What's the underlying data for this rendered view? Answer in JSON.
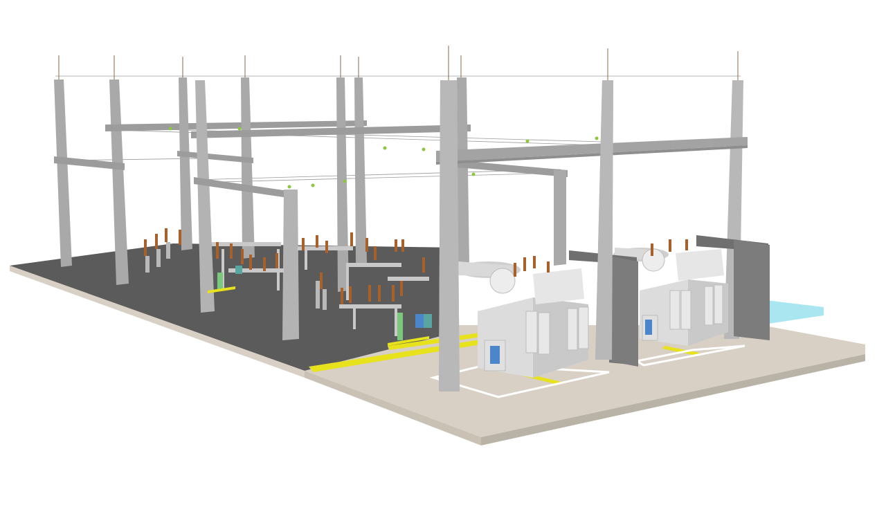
{
  "scene": {
    "subject": "substation-3d-render",
    "colors": {
      "background": "#ffffff",
      "asphalt": "#5b5b5b",
      "gravel": "#d8d0c4",
      "slab_edge": "#b9b2a6",
      "concrete": "#a9a9a9",
      "concrete_dark": "#8e8e8e",
      "concrete_light": "#c4c4c4",
      "insulator": "#a8612a",
      "cable_trench": "#e7e21b",
      "transformer": "#dcdcdc",
      "transformer_shadow": "#bdbdbd",
      "firewall": "#6f6f6f",
      "water": "#a9e6ef",
      "panel_blue": "#4a86c9"
    },
    "icons": [
      "lattice-portal",
      "power-transformer",
      "firewall",
      "insulator"
    ]
  }
}
